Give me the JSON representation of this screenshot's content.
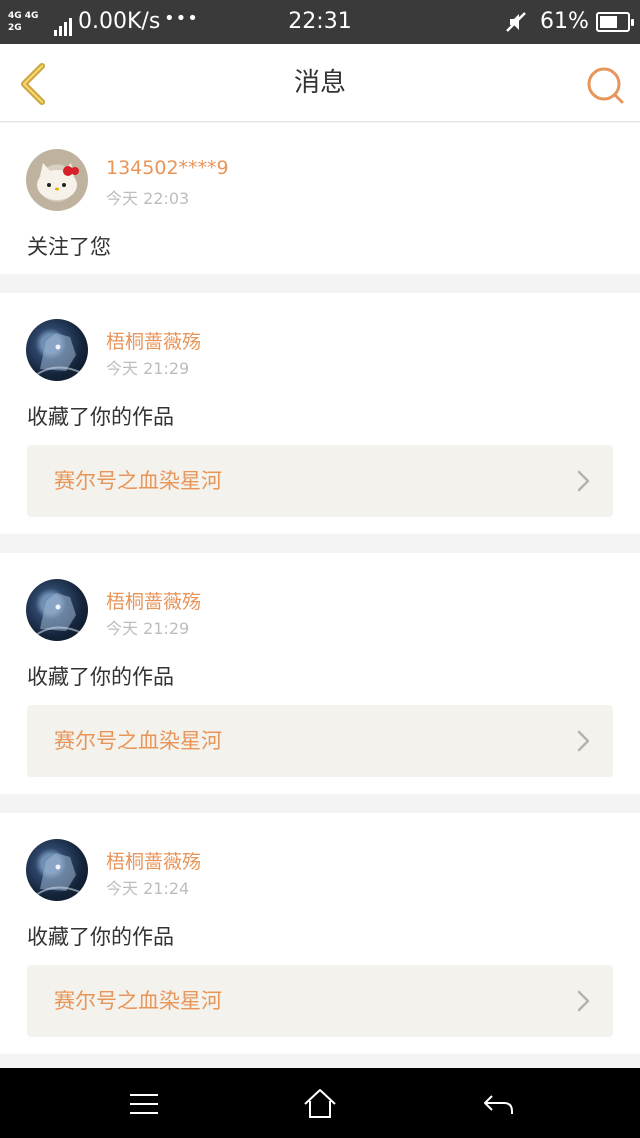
{
  "status_bar": {
    "net_top": "4G 4G",
    "net_bottom": "2G",
    "speed": "0.00K/s",
    "dots": "•••",
    "time": "22:31",
    "battery": "61%"
  },
  "header": {
    "title": "消息",
    "accent_color": "#e8955a"
  },
  "notifications": [
    {
      "username": "134502****9",
      "time": "今天 22:03",
      "message": "关注了您",
      "avatar": "hello-kitty-avatar"
    },
    {
      "username": "梧桐蔷薇殇",
      "time": "今天 21:29",
      "message": "收藏了你的作品",
      "work_title": "赛尔号之血染星河",
      "avatar": "wolf-avatar"
    },
    {
      "username": "梧桐蔷薇殇",
      "time": "今天 21:29",
      "message": "收藏了你的作品",
      "work_title": "赛尔号之血染星河",
      "avatar": "wolf-avatar"
    },
    {
      "username": "梧桐蔷薇殇",
      "time": "今天 21:24",
      "message": "收藏了你的作品",
      "work_title": "赛尔号之血染星河",
      "avatar": "wolf-avatar"
    }
  ],
  "nav": {
    "icons": [
      "menu-icon",
      "home-icon",
      "back-icon"
    ]
  }
}
